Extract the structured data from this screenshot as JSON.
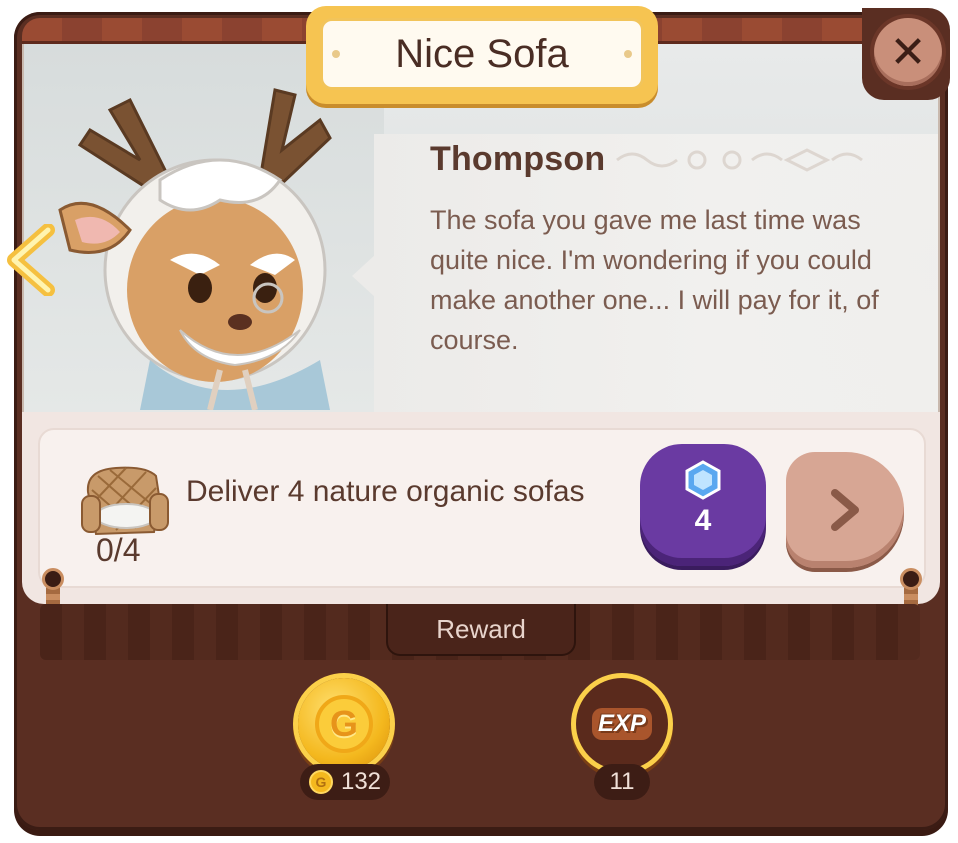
{
  "title": "Nice Sofa",
  "dialog": {
    "speaker": "Thompson",
    "text": "The sofa you gave me last time was quite nice. I'm wondering if you could make another one... I will pay for it, of course."
  },
  "task": {
    "description": "Deliver 4 nature organic sofas",
    "progress": "0/4",
    "gem_cost": "4"
  },
  "reward": {
    "label": "Reward",
    "items": [
      {
        "icon": "gold-coin-icon",
        "amount": "132"
      },
      {
        "icon": "exp-icon",
        "amount": "11"
      }
    ]
  },
  "colors": {
    "frame": "#5a2e22",
    "title_plate": "#f6c451",
    "gem_button": "#6a3aa2",
    "next_button": "#d7a694"
  }
}
